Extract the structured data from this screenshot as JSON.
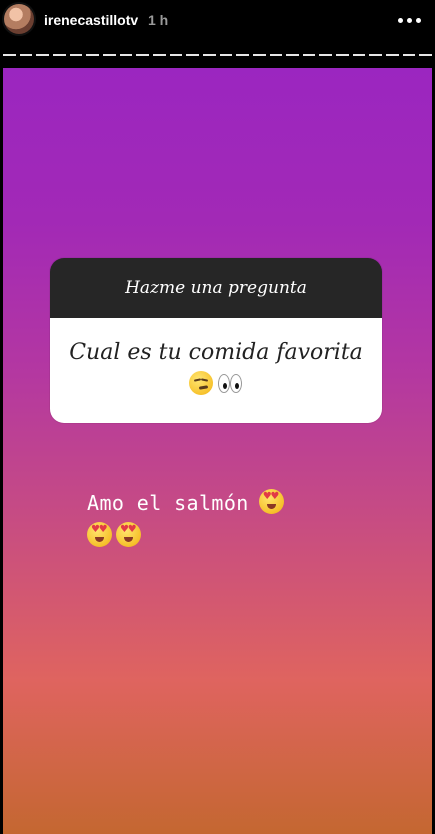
{
  "header": {
    "username": "irenecastillotv",
    "timestamp": "1 h",
    "more_icon": "more-options-icon",
    "progress_segments": 26
  },
  "story": {
    "question_box": {
      "title": "Hazme una pregunta",
      "question": "Cual es tu comida favorita",
      "emojis": [
        "smirk-emoji",
        "eyes-emoji"
      ]
    },
    "answer": {
      "text": "Amo el salmón",
      "emojis": [
        "heart-eyes-emoji",
        "heart-eyes-emoji",
        "heart-eyes-emoji"
      ]
    }
  },
  "colors": {
    "background": "#000000",
    "story_top": "#9b26c0",
    "story_mid": "#c64b84",
    "story_bottom": "#c46731",
    "question_header": "#262626",
    "question_body": "#ffffff"
  }
}
